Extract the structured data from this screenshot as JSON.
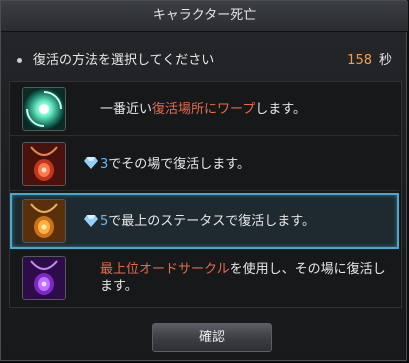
{
  "dialog": {
    "title": "キャラクター死亡",
    "prompt": "復活の方法を選択してください",
    "countdown": "158",
    "countdown_unit": "秒"
  },
  "options": [
    {
      "icon": "warp-portal-icon",
      "text_pre": "一番近い ",
      "text_accent": "復活場所にワープ",
      "text_post": "します。"
    },
    {
      "icon": "amulet-red-icon",
      "cost_icon": "diamond-icon",
      "cost": "3",
      "text": "でその場で復活します。"
    },
    {
      "icon": "amulet-orange-icon",
      "cost_icon": "diamond-icon",
      "cost": "5",
      "text": "で最上のステータスで復活します。",
      "selected": true
    },
    {
      "icon": "amulet-purple-icon",
      "text_accent": "最上位オードサークル",
      "text_line1_post": "を使用し、その場に復活し",
      "text_line2": "ます。"
    }
  ],
  "footer": {
    "confirm_label": "確認"
  },
  "colors": {
    "accent_orange": "#f0a24a",
    "accent_red": "#e86a4a",
    "accent_blue": "#6ab4f4",
    "selection_border": "#4aa9c9"
  }
}
